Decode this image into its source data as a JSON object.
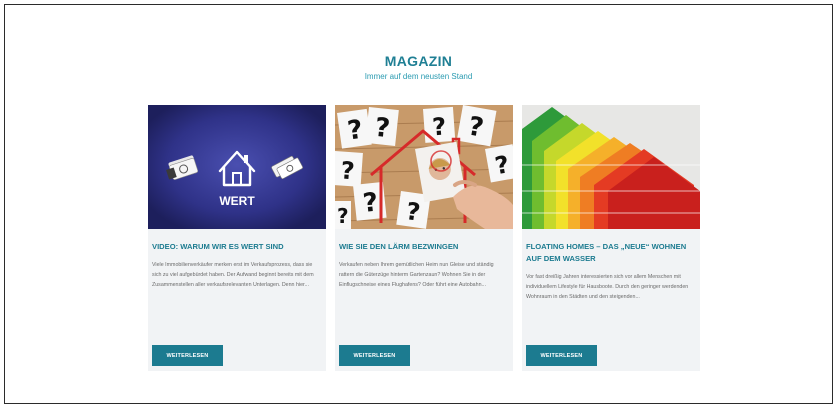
{
  "section": {
    "title": "MAGAZIN",
    "subtitle": "Immer auf dem neusten Stand"
  },
  "cards": [
    {
      "image_label": "WERT",
      "title": "VIDEO: WARUM WIR ES WERT SIND",
      "text": "Viele Immobilienverkäufer merken erst im Verkaufsprozess, dass sie sich zu viel aufgebürdet haben. Der Aufwand beginnt bereits mit dem Zusammenstellen aller verkaufsrelevanten Unterlagen. Denn hier...",
      "button": "WEITERLESEN"
    },
    {
      "title": "WIE SIE DEN LÄRM BEZWINGEN",
      "text": "Verkaufen neben Ihrem gemütlichen Heim nun Gleise und ständig rattern die Güterzüge hinterm Gartenzaun? Wohnen Sie in der Einflugschneise eines Flughafens? Oder führt eine Autobahn...",
      "button": "WEITERLESEN"
    },
    {
      "title": "FLOATING HOMES – DAS „NEUE“ WOHNEN AUF DEM WASSER",
      "text": "Vor fast dreißig Jahren interessierten sich vor allem Menschen mit individuellem Lifestyle für Hausboote. Durch den geringer werdenden Wohnraum in den Städten und den steigenden...",
      "button": "WEITERLESEN"
    }
  ],
  "colors": {
    "accent": "#1c7b90",
    "subtitle": "#2a9bb1",
    "card_bg": "#f1f3f5"
  }
}
